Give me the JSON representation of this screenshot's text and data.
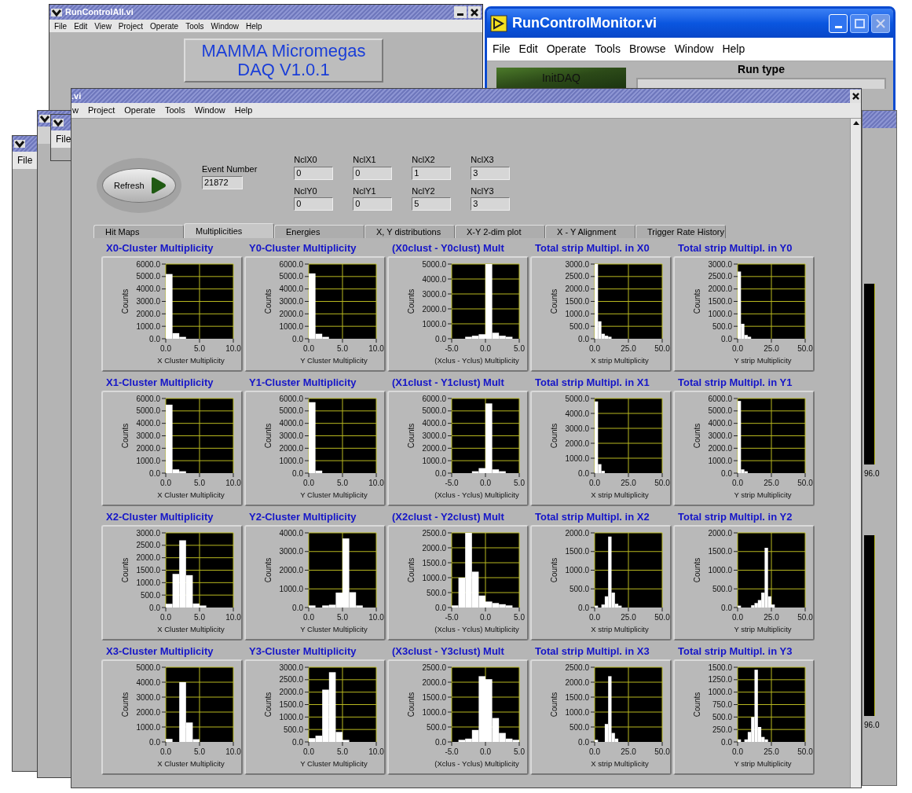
{
  "run_control_all": {
    "title": "RunControlAll.vi",
    "menu": [
      "File",
      "Edit",
      "View",
      "Project",
      "Operate",
      "Tools",
      "Window",
      "Help"
    ],
    "banner": [
      "MAMMA Micromegas",
      "DAQ V1.0.1"
    ]
  },
  "run_control_monitor": {
    "title": "RunControlMonitor.vi",
    "menu": [
      "File",
      "Edit",
      "Operate",
      "Tools",
      "Browse",
      "Window",
      "Help"
    ],
    "init_button": "InitDAQ",
    "run_type_label": "Run type"
  },
  "right_window": {
    "axis_labels": [
      "96.0",
      "96.0"
    ]
  },
  "back_windows": [
    {
      "kind": "menu",
      "menu_item": "File"
    },
    {
      "kind": "plain"
    },
    {
      "kind": "menu",
      "menu_item": "File"
    }
  ],
  "main_window": {
    "title": ".vi",
    "menu": [
      "w",
      "Project",
      "Operate",
      "Tools",
      "Window",
      "Help"
    ],
    "refresh_button": "Refresh",
    "event_number": {
      "label": "Event Number",
      "value": "21872"
    },
    "counters": [
      {
        "label": "NclX0",
        "value": "0"
      },
      {
        "label": "NclX1",
        "value": "0"
      },
      {
        "label": "NclX2",
        "value": "1"
      },
      {
        "label": "NclX3",
        "value": "3"
      },
      {
        "label": "NclY0",
        "value": "0"
      },
      {
        "label": "NclY1",
        "value": "0"
      },
      {
        "label": "NclY2",
        "value": "5"
      },
      {
        "label": "NclY3",
        "value": "3"
      }
    ],
    "tabs": [
      {
        "label": "Hit Maps",
        "selected": false
      },
      {
        "label": "Multiplicities",
        "selected": true
      },
      {
        "label": "Energies",
        "selected": false
      },
      {
        "label": "X, Y distributions",
        "selected": false
      },
      {
        "label": "X-Y 2-dim plot",
        "selected": false
      },
      {
        "label": "X - Y Alignment",
        "selected": false
      },
      {
        "label": "Trigger Rate History",
        "selected": false
      }
    ],
    "charts": [
      {
        "title": "X0-Cluster Multiplicity",
        "chart_data": {
          "type": "bar",
          "grid": true,
          "xlabel": "X Cluster Multiplicity",
          "ylabel": "Counts",
          "x": [
            0.5,
            1.5,
            2.5
          ],
          "values": [
            5200,
            450,
            150
          ],
          "xlim": [
            0,
            10
          ],
          "ylim": [
            0,
            6000
          ],
          "xticks": [
            {
              "value": 0,
              "label": "0.0"
            },
            {
              "value": 5,
              "label": "5.0"
            },
            {
              "value": 10,
              "label": "10.0"
            }
          ],
          "yticks": [
            {
              "value": 0,
              "label": "0.0"
            },
            {
              "value": 1000,
              "label": "1000.0"
            },
            {
              "value": 2000,
              "label": "2000.0"
            },
            {
              "value": 3000,
              "label": "3000.0"
            },
            {
              "value": 4000,
              "label": "4000.0"
            },
            {
              "value": 5000,
              "label": "5000.0"
            },
            {
              "value": 6000,
              "label": "6000.0"
            }
          ]
        }
      },
      {
        "title": "Y0-Cluster Multiplicity",
        "chart_data": {
          "type": "bar",
          "grid": true,
          "xlabel": "Y Cluster Multiplicity",
          "ylabel": "Counts",
          "x": [
            0.5,
            1.5,
            2.5
          ],
          "values": [
            5250,
            400,
            150
          ],
          "xlim": [
            0,
            10
          ],
          "ylim": [
            0,
            6000
          ],
          "xticks": [
            {
              "value": 0,
              "label": "0.0"
            },
            {
              "value": 5,
              "label": "5.0"
            },
            {
              "value": 10,
              "label": "10.0"
            }
          ],
          "yticks": [
            {
              "value": 0,
              "label": "0.0"
            },
            {
              "value": 1000,
              "label": "1000.0"
            },
            {
              "value": 2000,
              "label": "2000.0"
            },
            {
              "value": 3000,
              "label": "3000.0"
            },
            {
              "value": 4000,
              "label": "4000.0"
            },
            {
              "value": 5000,
              "label": "5000.0"
            },
            {
              "value": 6000,
              "label": "6000.0"
            }
          ]
        }
      },
      {
        "title": "(X0clust - Y0clust) Mult",
        "chart_data": {
          "type": "bar",
          "grid": true,
          "xlabel": "(Xclus - Yclus) Multiplicity",
          "ylabel": "Counts",
          "x": [
            -2.5,
            -1.5,
            -0.5,
            0.5,
            1.5,
            2.5,
            3.5
          ],
          "values": [
            130,
            200,
            300,
            5000,
            400,
            200,
            130
          ],
          "xlim": [
            -5,
            5
          ],
          "ylim": [
            0,
            5000
          ],
          "xticks": [
            {
              "value": -5,
              "label": "-5.0"
            },
            {
              "value": 0,
              "label": "0.0"
            },
            {
              "value": 5,
              "label": "5.0"
            }
          ],
          "yticks": [
            {
              "value": 0,
              "label": "0.0"
            },
            {
              "value": 1000,
              "label": "1000.0"
            },
            {
              "value": 2000,
              "label": "2000.0"
            },
            {
              "value": 3000,
              "label": "3000.0"
            },
            {
              "value": 4000,
              "label": "4000.0"
            },
            {
              "value": 5000,
              "label": "5000.0"
            }
          ]
        }
      },
      {
        "title": "Total strip Multipl. in X0",
        "chart_data": {
          "type": "bar",
          "grid": true,
          "xlabel": "X strip Multiplicity",
          "ylabel": "Counts",
          "x": [
            1.25,
            3.75,
            6.25,
            8.75,
            11.25
          ],
          "values": [
            3000,
            700,
            200,
            120,
            80
          ],
          "xlim": [
            0,
            50
          ],
          "ylim": [
            0,
            3000
          ],
          "xticks": [
            {
              "value": 0,
              "label": "0.0"
            },
            {
              "value": 25,
              "label": "25.0"
            },
            {
              "value": 50,
              "label": "50.0"
            }
          ],
          "yticks": [
            {
              "value": 0,
              "label": "0.0"
            },
            {
              "value": 500,
              "label": "500.0"
            },
            {
              "value": 1000,
              "label": "1000.0"
            },
            {
              "value": 1500,
              "label": "1500.0"
            },
            {
              "value": 2000,
              "label": "2000.0"
            },
            {
              "value": 2500,
              "label": "2500.0"
            },
            {
              "value": 3000,
              "label": "3000.0"
            }
          ]
        }
      },
      {
        "title": "Total strip Multipl. in Y0",
        "chart_data": {
          "type": "bar",
          "grid": true,
          "xlabel": "Y strip Multiplicity",
          "ylabel": "Counts",
          "x": [
            1.25,
            3.75,
            6.25,
            8.75
          ],
          "values": [
            2700,
            600,
            150,
            80
          ],
          "xlim": [
            0,
            50
          ],
          "ylim": [
            0,
            3000
          ],
          "xticks": [
            {
              "value": 0,
              "label": "0.0"
            },
            {
              "value": 25,
              "label": "25.0"
            },
            {
              "value": 50,
              "label": "50.0"
            }
          ],
          "yticks": [
            {
              "value": 0,
              "label": "0.0"
            },
            {
              "value": 500,
              "label": "500.0"
            },
            {
              "value": 1000,
              "label": "1000.0"
            },
            {
              "value": 1500,
              "label": "1500.0"
            },
            {
              "value": 2000,
              "label": "2000.0"
            },
            {
              "value": 2500,
              "label": "2500.0"
            },
            {
              "value": 3000,
              "label": "3000.0"
            }
          ]
        }
      },
      {
        "title": "X1-Cluster Multiplicity",
        "chart_data": {
          "type": "bar",
          "grid": true,
          "xlabel": "X Cluster Multiplicity",
          "ylabel": "Counts",
          "x": [
            0.5,
            1.5,
            2.5
          ],
          "values": [
            5500,
            300,
            150
          ],
          "xlim": [
            0,
            10
          ],
          "ylim": [
            0,
            6000
          ],
          "xticks": [
            {
              "value": 0,
              "label": "0.0"
            },
            {
              "value": 5,
              "label": "5.0"
            },
            {
              "value": 10,
              "label": "10.0"
            }
          ],
          "yticks": [
            {
              "value": 0,
              "label": "0.0"
            },
            {
              "value": 1000,
              "label": "1000.0"
            },
            {
              "value": 2000,
              "label": "2000.0"
            },
            {
              "value": 3000,
              "label": "3000.0"
            },
            {
              "value": 4000,
              "label": "4000.0"
            },
            {
              "value": 5000,
              "label": "5000.0"
            },
            {
              "value": 6000,
              "label": "6000.0"
            }
          ]
        }
      },
      {
        "title": "Y1-Cluster Multiplicity",
        "chart_data": {
          "type": "bar",
          "grid": true,
          "xlabel": "Y Cluster Multiplicity",
          "ylabel": "Counts",
          "x": [
            0.5,
            1.5
          ],
          "values": [
            5700,
            200
          ],
          "xlim": [
            0,
            10
          ],
          "ylim": [
            0,
            6000
          ],
          "xticks": [
            {
              "value": 0,
              "label": "0.0"
            },
            {
              "value": 5,
              "label": "5.0"
            },
            {
              "value": 10,
              "label": "10.0"
            }
          ],
          "yticks": [
            {
              "value": 0,
              "label": "0.0"
            },
            {
              "value": 1000,
              "label": "1000.0"
            },
            {
              "value": 2000,
              "label": "2000.0"
            },
            {
              "value": 3000,
              "label": "3000.0"
            },
            {
              "value": 4000,
              "label": "4000.0"
            },
            {
              "value": 5000,
              "label": "5000.0"
            },
            {
              "value": 6000,
              "label": "6000.0"
            }
          ]
        }
      },
      {
        "title": "(X1clust - Y1clust) Mult",
        "chart_data": {
          "type": "bar",
          "grid": true,
          "xlabel": "(Xclus - Yclus) Multiplicity",
          "ylabel": "Counts",
          "x": [
            -1.5,
            -0.5,
            0.5,
            1.5,
            2.5
          ],
          "values": [
            150,
            400,
            5600,
            300,
            150
          ],
          "xlim": [
            -5,
            5
          ],
          "ylim": [
            0,
            6000
          ],
          "xticks": [
            {
              "value": -5,
              "label": "-5.0"
            },
            {
              "value": 0,
              "label": "0.0"
            },
            {
              "value": 5,
              "label": "5.0"
            }
          ],
          "yticks": [
            {
              "value": 0,
              "label": "0.0"
            },
            {
              "value": 1000,
              "label": "1000.0"
            },
            {
              "value": 2000,
              "label": "2000.0"
            },
            {
              "value": 3000,
              "label": "3000.0"
            },
            {
              "value": 4000,
              "label": "4000.0"
            },
            {
              "value": 5000,
              "label": "5000.0"
            },
            {
              "value": 6000,
              "label": "6000.0"
            }
          ]
        }
      },
      {
        "title": "Total strip Multipl. in X1",
        "chart_data": {
          "type": "bar",
          "grid": true,
          "xlabel": "X strip Multiplicity",
          "ylabel": "Counts",
          "x": [
            1.25,
            3.75,
            6.25
          ],
          "values": [
            4800,
            600,
            150
          ],
          "xlim": [
            0,
            50
          ],
          "ylim": [
            0,
            5000
          ],
          "xticks": [
            {
              "value": 0,
              "label": "0.0"
            },
            {
              "value": 25,
              "label": "25.0"
            },
            {
              "value": 50,
              "label": "50.0"
            }
          ],
          "yticks": [
            {
              "value": 0,
              "label": "0.0"
            },
            {
              "value": 1000,
              "label": "1000.0"
            },
            {
              "value": 2000,
              "label": "2000.0"
            },
            {
              "value": 3000,
              "label": "3000.0"
            },
            {
              "value": 4000,
              "label": "4000.0"
            },
            {
              "value": 5000,
              "label": "5000.0"
            }
          ]
        }
      },
      {
        "title": "Total strip Multipl. in Y1",
        "chart_data": {
          "type": "bar",
          "grid": true,
          "xlabel": "Y strip Multiplicity",
          "ylabel": "Counts",
          "x": [
            1.25,
            3.75,
            6.25
          ],
          "values": [
            5800,
            300,
            150
          ],
          "xlim": [
            0,
            50
          ],
          "ylim": [
            0,
            6000
          ],
          "xticks": [
            {
              "value": 0,
              "label": "0.0"
            },
            {
              "value": 25,
              "label": "25.0"
            },
            {
              "value": 50,
              "label": "50.0"
            }
          ],
          "yticks": [
            {
              "value": 0,
              "label": "0.0"
            },
            {
              "value": 1000,
              "label": "1000.0"
            },
            {
              "value": 2000,
              "label": "2000.0"
            },
            {
              "value": 3000,
              "label": "3000.0"
            },
            {
              "value": 4000,
              "label": "4000.0"
            },
            {
              "value": 5000,
              "label": "5000.0"
            },
            {
              "value": 6000,
              "label": "6000.0"
            }
          ]
        }
      },
      {
        "title": "X2-Cluster Multiplicity",
        "chart_data": {
          "type": "bar",
          "grid": true,
          "xlabel": "X Cluster Multiplicity",
          "ylabel": "Counts",
          "x": [
            0.5,
            1.5,
            2.5,
            3.5,
            4.5,
            5.5
          ],
          "values": [
            150,
            1350,
            2700,
            1300,
            160,
            80
          ],
          "xlim": [
            0,
            10
          ],
          "ylim": [
            0,
            3000
          ],
          "xticks": [
            {
              "value": 0,
              "label": "0.0"
            },
            {
              "value": 5,
              "label": "5.0"
            },
            {
              "value": 10,
              "label": "10.0"
            }
          ],
          "yticks": [
            {
              "value": 0,
              "label": "0.0"
            },
            {
              "value": 500,
              "label": "500.0"
            },
            {
              "value": 1000,
              "label": "1000.0"
            },
            {
              "value": 1500,
              "label": "1500.0"
            },
            {
              "value": 2000,
              "label": "2000.0"
            },
            {
              "value": 2500,
              "label": "2500.0"
            },
            {
              "value": 3000,
              "label": "3000.0"
            }
          ]
        }
      },
      {
        "title": "Y2-Cluster Multiplicity",
        "chart_data": {
          "type": "bar",
          "grid": true,
          "xlabel": "Y Cluster Multiplicity",
          "ylabel": "Counts",
          "x": [
            0.5,
            2.5,
            3.5,
            4.5,
            5.5,
            6.5,
            7.5
          ],
          "values": [
            110,
            110,
            150,
            800,
            3700,
            820,
            110
          ],
          "xlim": [
            0,
            10
          ],
          "ylim": [
            0,
            4000
          ],
          "xticks": [
            {
              "value": 0,
              "label": "0.0"
            },
            {
              "value": 5,
              "label": "5.0"
            },
            {
              "value": 10,
              "label": "10.0"
            }
          ],
          "yticks": [
            {
              "value": 0,
              "label": "0.0"
            },
            {
              "value": 1000,
              "label": "1000.0"
            },
            {
              "value": 2000,
              "label": "2000.0"
            },
            {
              "value": 3000,
              "label": "3000.0"
            },
            {
              "value": 4000,
              "label": "4000.0"
            }
          ]
        }
      },
      {
        "title": "(X2clust - Y2clust) Mult",
        "chart_data": {
          "type": "bar",
          "grid": true,
          "xlabel": "(Xclus - Yclus) Multiplicity",
          "ylabel": "Counts",
          "x": [
            -4.5,
            -3.5,
            -2.5,
            -1.5,
            -0.5,
            0.5,
            1.5,
            2.5,
            3.5
          ],
          "values": [
            70,
            1000,
            2500,
            1200,
            400,
            200,
            150,
            110,
            70
          ],
          "xlim": [
            -5,
            5
          ],
          "ylim": [
            0,
            2500
          ],
          "xticks": [
            {
              "value": -5,
              "label": "-5.0"
            },
            {
              "value": 0,
              "label": "0.0"
            },
            {
              "value": 5,
              "label": "5.0"
            }
          ],
          "yticks": [
            {
              "value": 0,
              "label": "0.0"
            },
            {
              "value": 500,
              "label": "500.0"
            },
            {
              "value": 1000,
              "label": "1000.0"
            },
            {
              "value": 1500,
              "label": "1500.0"
            },
            {
              "value": 2000,
              "label": "2000.0"
            },
            {
              "value": 2500,
              "label": "2500.0"
            }
          ]
        }
      },
      {
        "title": "Total strip Multipl. in X2",
        "chart_data": {
          "type": "bar",
          "grid": true,
          "xlabel": "X strip Multiplicity",
          "ylabel": "Counts",
          "x": [
            1.25,
            6.25,
            8.75,
            11.25,
            13.75,
            16.25,
            18.75
          ],
          "values": [
            50,
            80,
            300,
            1900,
            400,
            100,
            50
          ],
          "xlim": [
            0,
            50
          ],
          "ylim": [
            0,
            2000
          ],
          "xticks": [
            {
              "value": 0,
              "label": "0.0"
            },
            {
              "value": 25,
              "label": "25.0"
            },
            {
              "value": 50,
              "label": "50.0"
            }
          ],
          "yticks": [
            {
              "value": 0,
              "label": "0.0"
            },
            {
              "value": 500,
              "label": "500.0"
            },
            {
              "value": 1000,
              "label": "1000.0"
            },
            {
              "value": 1500,
              "label": "1500.0"
            },
            {
              "value": 2000,
              "label": "2000.0"
            }
          ]
        }
      },
      {
        "title": "Total strip Multipl. in Y2",
        "chart_data": {
          "type": "bar",
          "grid": true,
          "xlabel": "Y strip Multiplicity",
          "ylabel": "Counts",
          "x": [
            1.25,
            11.25,
            13.75,
            16.25,
            18.75,
            21.25,
            23.75,
            26.25
          ],
          "values": [
            50,
            60,
            120,
            200,
            400,
            1600,
            300,
            80
          ],
          "xlim": [
            0,
            50
          ],
          "ylim": [
            0,
            2000
          ],
          "xticks": [
            {
              "value": 0,
              "label": "0.0"
            },
            {
              "value": 25,
              "label": "25.0"
            },
            {
              "value": 50,
              "label": "50.0"
            }
          ],
          "yticks": [
            {
              "value": 0,
              "label": "0.0"
            },
            {
              "value": 500,
              "label": "500.0"
            },
            {
              "value": 1000,
              "label": "1000.0"
            },
            {
              "value": 1500,
              "label": "1500.0"
            },
            {
              "value": 2000,
              "label": "2000.0"
            }
          ]
        }
      },
      {
        "title": "X3-Cluster Multiplicity",
        "chart_data": {
          "type": "bar",
          "grid": true,
          "xlabel": "X Cluster Multiplicity",
          "ylabel": "Counts",
          "x": [
            0.5,
            2.5,
            3.5,
            4.5
          ],
          "values": [
            200,
            4000,
            1300,
            180
          ],
          "xlim": [
            0,
            10
          ],
          "ylim": [
            0,
            5000
          ],
          "xticks": [
            {
              "value": 0,
              "label": "0.0"
            },
            {
              "value": 5,
              "label": "5.0"
            },
            {
              "value": 10,
              "label": "10.0"
            }
          ],
          "yticks": [
            {
              "value": 0,
              "label": "0.0"
            },
            {
              "value": 1000,
              "label": "1000.0"
            },
            {
              "value": 2000,
              "label": "2000.0"
            },
            {
              "value": 3000,
              "label": "3000.0"
            },
            {
              "value": 4000,
              "label": "4000.0"
            },
            {
              "value": 5000,
              "label": "5000.0"
            }
          ]
        }
      },
      {
        "title": "Y3-Cluster Multiplicity",
        "chart_data": {
          "type": "bar",
          "grid": true,
          "xlabel": "Y Cluster Multiplicity",
          "ylabel": "Counts",
          "x": [
            0.5,
            1.5,
            2.5,
            3.5,
            4.5,
            5.5
          ],
          "values": [
            150,
            250,
            2100,
            2800,
            400,
            80
          ],
          "xlim": [
            0,
            10
          ],
          "ylim": [
            0,
            3000
          ],
          "xticks": [
            {
              "value": 0,
              "label": "0.0"
            },
            {
              "value": 5,
              "label": "5.0"
            },
            {
              "value": 10,
              "label": "10.0"
            }
          ],
          "yticks": [
            {
              "value": 0,
              "label": "0.0"
            },
            {
              "value": 500,
              "label": "500.0"
            },
            {
              "value": 1000,
              "label": "1000.0"
            },
            {
              "value": 1500,
              "label": "1500.0"
            },
            {
              "value": 2000,
              "label": "2000.0"
            },
            {
              "value": 2500,
              "label": "2500.0"
            },
            {
              "value": 3000,
              "label": "3000.0"
            }
          ]
        }
      },
      {
        "title": "(X3clust - Y3clust) Mult",
        "chart_data": {
          "type": "bar",
          "grid": true,
          "xlabel": "(Xclus - Yclus) Multiplicity",
          "ylabel": "Counts",
          "x": [
            -3.5,
            -2.5,
            -1.5,
            -0.5,
            0.5,
            1.5,
            2.5,
            3.5,
            4.5
          ],
          "values": [
            70,
            110,
            400,
            2200,
            2100,
            800,
            300,
            110,
            70
          ],
          "xlim": [
            -5,
            5
          ],
          "ylim": [
            0,
            2500
          ],
          "xticks": [
            {
              "value": -5,
              "label": "-5.0"
            },
            {
              "value": 0,
              "label": "0.0"
            },
            {
              "value": 5,
              "label": "5.0"
            }
          ],
          "yticks": [
            {
              "value": 0,
              "label": "0.0"
            },
            {
              "value": 500,
              "label": "500.0"
            },
            {
              "value": 1000,
              "label": "1000.0"
            },
            {
              "value": 1500,
              "label": "1500.0"
            },
            {
              "value": 2000,
              "label": "2000.0"
            },
            {
              "value": 2500,
              "label": "2500.0"
            }
          ]
        }
      },
      {
        "title": "Total strip Multipl. in X3",
        "chart_data": {
          "type": "bar",
          "grid": true,
          "xlabel": "X strip Multiplicity",
          "ylabel": "Counts",
          "x": [
            1.25,
            8.75,
            11.25,
            13.75,
            16.25
          ],
          "values": [
            70,
            600,
            2200,
            300,
            110
          ],
          "xlim": [
            0,
            50
          ],
          "ylim": [
            0,
            2500
          ],
          "xticks": [
            {
              "value": 0,
              "label": "0.0"
            },
            {
              "value": 25,
              "label": "25.0"
            },
            {
              "value": 50,
              "label": "50.0"
            }
          ],
          "yticks": [
            {
              "value": 0,
              "label": "0.0"
            },
            {
              "value": 500,
              "label": "500.0"
            },
            {
              "value": 1000,
              "label": "1000.0"
            },
            {
              "value": 1500,
              "label": "1500.0"
            },
            {
              "value": 2000,
              "label": "2000.0"
            },
            {
              "value": 2500,
              "label": "2500.0"
            }
          ]
        }
      },
      {
        "title": "Total strip Multipl. in Y3",
        "chart_data": {
          "type": "bar",
          "grid": true,
          "xlabel": "Y strip Multiplicity",
          "ylabel": "Counts",
          "x": [
            1.25,
            6.25,
            8.75,
            11.25,
            13.75,
            16.25,
            18.75,
            21.25
          ],
          "values": [
            50,
            50,
            200,
            500,
            1450,
            300,
            100,
            50
          ],
          "xlim": [
            0,
            50
          ],
          "ylim": [
            0,
            1500
          ],
          "xticks": [
            {
              "value": 0,
              "label": "0.0"
            },
            {
              "value": 25,
              "label": "25.0"
            },
            {
              "value": 50,
              "label": "50.0"
            }
          ],
          "yticks": [
            {
              "value": 0,
              "label": "0.0"
            },
            {
              "value": 250,
              "label": "250.0"
            },
            {
              "value": 500,
              "label": "500.0"
            },
            {
              "value": 750,
              "label": "750.0"
            },
            {
              "value": 1000,
              "label": "1000.0"
            },
            {
              "value": 1250,
              "label": "1250.0"
            },
            {
              "value": 1500,
              "label": "1500.0"
            }
          ]
        }
      }
    ]
  }
}
